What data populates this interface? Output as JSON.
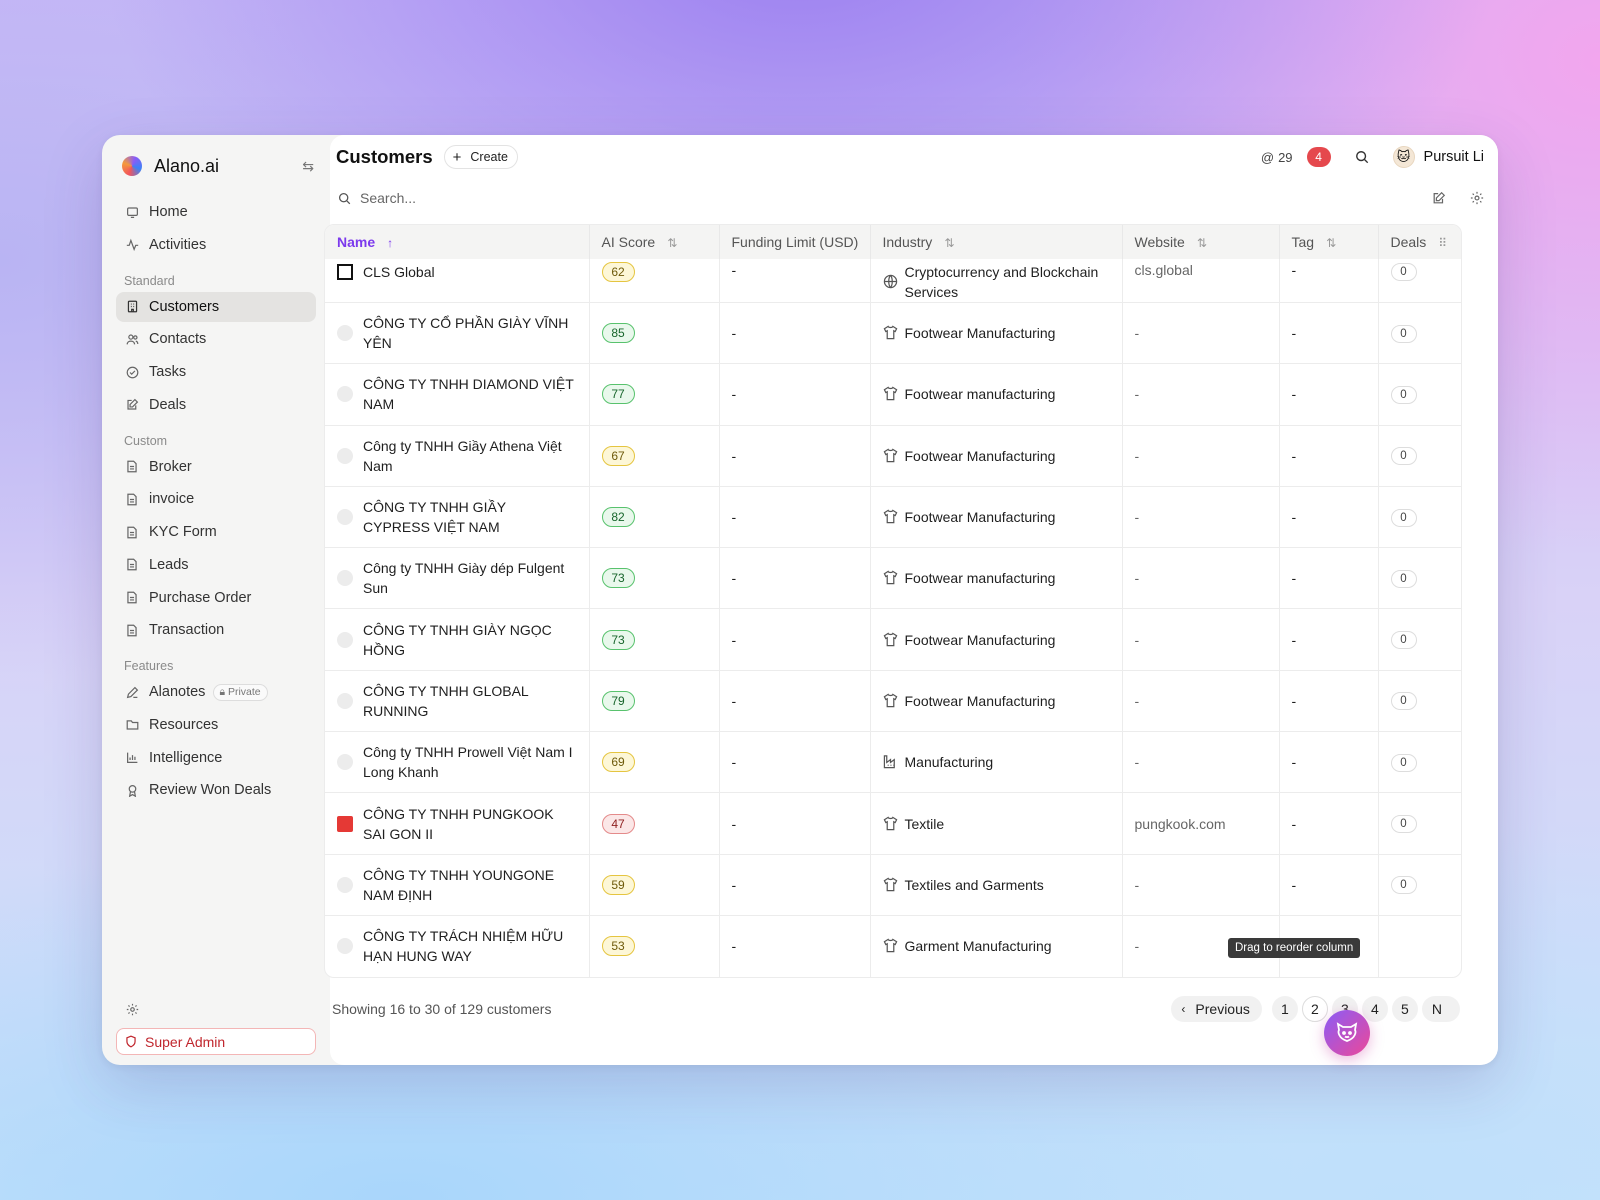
{
  "brand": {
    "name": "Alano.ai"
  },
  "nav_main": [
    {
      "label": "Home",
      "icon": "monitor-icon"
    },
    {
      "label": "Activities",
      "icon": "activity-icon"
    }
  ],
  "sections": {
    "standard": "Standard",
    "custom": "Custom",
    "features": "Features"
  },
  "nav_standard": [
    {
      "label": "Customers",
      "icon": "building-icon",
      "active": true
    },
    {
      "label": "Contacts",
      "icon": "users-icon"
    },
    {
      "label": "Tasks",
      "icon": "check-circle-icon"
    },
    {
      "label": "Deals",
      "icon": "edit-doc-icon"
    }
  ],
  "nav_custom": [
    {
      "label": "Broker"
    },
    {
      "label": "invoice"
    },
    {
      "label": "KYC Form"
    },
    {
      "label": "Leads"
    },
    {
      "label": "Purchase Order"
    },
    {
      "label": "Transaction"
    }
  ],
  "nav_features": [
    {
      "label": "Alanotes",
      "badge": "Private"
    },
    {
      "label": "Resources"
    },
    {
      "label": "Intelligence"
    },
    {
      "label": "Review Won Deals"
    }
  ],
  "super_admin": "Super Admin",
  "header": {
    "title": "Customers",
    "create_label": "Create",
    "mentions": "29",
    "notifications": "4",
    "user_name": "Pursuit Li"
  },
  "search": {
    "placeholder": "Search..."
  },
  "columns": {
    "name": "Name",
    "ai_score": "AI Score",
    "funding": "Funding Limit (USD)",
    "industry": "Industry",
    "website": "Website",
    "tag": "Tag",
    "deals": "Deals"
  },
  "rows": [
    {
      "name": "CLS Global",
      "icon": "box",
      "score": "62",
      "score_color": "yellow",
      "funding": "-",
      "industry": "Cryptocurrency and Blockchain Services",
      "industry_icon": "globe",
      "website": "cls.global",
      "tag": "-",
      "deals": "0"
    },
    {
      "name": "CÔNG TY CỔ PHẦN GIÀY VĨNH YÊN",
      "icon": "circle",
      "score": "85",
      "score_color": "green",
      "funding": "-",
      "industry": "Footwear Manufacturing",
      "industry_icon": "shirt",
      "website": "-",
      "tag": "-",
      "deals": "0"
    },
    {
      "name": "CÔNG TY TNHH DIAMOND VIỆT NAM",
      "icon": "circle",
      "score": "77",
      "score_color": "green",
      "funding": "-",
      "industry": "Footwear manufacturing",
      "industry_icon": "shirt",
      "website": "-",
      "tag": "-",
      "deals": "0"
    },
    {
      "name": "Công ty TNHH Giầy Athena Việt Nam",
      "icon": "circle",
      "score": "67",
      "score_color": "yellow",
      "funding": "-",
      "industry": "Footwear Manufacturing",
      "industry_icon": "shirt",
      "website": "-",
      "tag": "-",
      "deals": "0"
    },
    {
      "name": "CÔNG TY TNHH GIẦY CYPRESS VIỆT NAM",
      "icon": "circle",
      "score": "82",
      "score_color": "green",
      "funding": "-",
      "industry": "Footwear Manufacturing",
      "industry_icon": "shirt",
      "website": "-",
      "tag": "-",
      "deals": "0"
    },
    {
      "name": "Công ty TNHH Giày dép Fulgent Sun",
      "icon": "circle",
      "score": "73",
      "score_color": "green",
      "funding": "-",
      "industry": "Footwear manufacturing",
      "industry_icon": "shirt",
      "website": "-",
      "tag": "-",
      "deals": "0"
    },
    {
      "name": "CÔNG TY TNHH GIÀY NGỌC HỒNG",
      "icon": "circle",
      "score": "73",
      "score_color": "green",
      "funding": "-",
      "industry": "Footwear Manufacturing",
      "industry_icon": "shirt",
      "website": "-",
      "tag": "-",
      "deals": "0"
    },
    {
      "name": "CÔNG TY TNHH GLOBAL RUNNING",
      "icon": "circle",
      "score": "79",
      "score_color": "green",
      "funding": "-",
      "industry": "Footwear Manufacturing",
      "industry_icon": "shirt",
      "website": "-",
      "tag": "-",
      "deals": "0"
    },
    {
      "name": "Công ty TNHH Prowell Việt Nam I Long Khanh",
      "icon": "circle",
      "score": "69",
      "score_color": "yellow",
      "funding": "-",
      "industry": "Manufacturing",
      "industry_icon": "factory",
      "website": "-",
      "tag": "-",
      "deals": "0"
    },
    {
      "name": "CÔNG TY TNHH PUNGKOOK SAI GON II",
      "icon": "pk",
      "score": "47",
      "score_color": "red",
      "funding": "-",
      "industry": "Textile",
      "industry_icon": "shirt",
      "website": "pungkook.com",
      "tag": "-",
      "deals": "0"
    },
    {
      "name": "CÔNG TY TNHH YOUNGONE NAM ĐỊNH",
      "icon": "circle",
      "score": "59",
      "score_color": "yellow",
      "funding": "-",
      "industry": "Textiles and Garments",
      "industry_icon": "shirt",
      "website": "-",
      "tag": "-",
      "deals": "0"
    },
    {
      "name": "CÔNG TY TRÁCH NHIỆM HỮU HẠN HUNG WAY",
      "icon": "circle",
      "score": "53",
      "score_color": "yellow",
      "funding": "-",
      "industry": "Garment Manufacturing",
      "industry_icon": "shirt",
      "website": "-",
      "tag": "-",
      "deals": ""
    }
  ],
  "tooltip": "Drag to reorder column",
  "footer": {
    "showing": "Showing 16 to 30 of 129 customers",
    "previous": "Previous",
    "pages": [
      "1",
      "2",
      "3",
      "4",
      "5"
    ],
    "current_page": "2",
    "next": "N"
  },
  "colors": {
    "accent": "#7c3aed",
    "danger": "#e5484d"
  }
}
